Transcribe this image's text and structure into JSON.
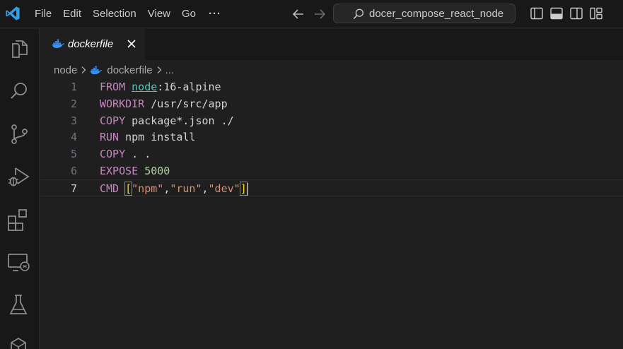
{
  "titlebar": {
    "menu": [
      "File",
      "Edit",
      "Selection",
      "View",
      "Go",
      "···"
    ],
    "search_text": "docer_compose_react_node"
  },
  "activity_icons": [
    "explorer-icon",
    "search-icon",
    "source-control-icon",
    "run-debug-icon",
    "extensions-icon",
    "remote-explorer-icon",
    "testing-icon",
    "docker-icon"
  ],
  "tab": {
    "label": "dockerfile",
    "close": "×"
  },
  "breadcrumb": {
    "folder": "node",
    "file": "dockerfile",
    "ellipsis": "..."
  },
  "editor": {
    "lines": [
      {
        "n": "1",
        "keyword": "FROM",
        "image": "node",
        "rest": ":16-alpine"
      },
      {
        "n": "2",
        "keyword": "WORKDIR",
        "rest": " /usr/src/app"
      },
      {
        "n": "3",
        "keyword": "COPY",
        "rest": " package*.json ./"
      },
      {
        "n": "4",
        "keyword": "RUN",
        "rest": " npm install"
      },
      {
        "n": "5",
        "keyword": "COPY",
        "rest": " . ."
      },
      {
        "n": "6",
        "keyword": "EXPOSE",
        "number": "5000"
      },
      {
        "n": "7",
        "keyword": "CMD",
        "open": "[",
        "args": [
          "\"npm\"",
          "\"run\"",
          "\"dev\""
        ],
        "close": "]"
      }
    ],
    "current_line": "7"
  },
  "colors": {
    "accent": "#0078d4",
    "keyword": "#c586c0",
    "base_image": "#4ec9b0",
    "number": "#b5cea8",
    "string": "#ce9178",
    "bracket": "#ffd700"
  }
}
